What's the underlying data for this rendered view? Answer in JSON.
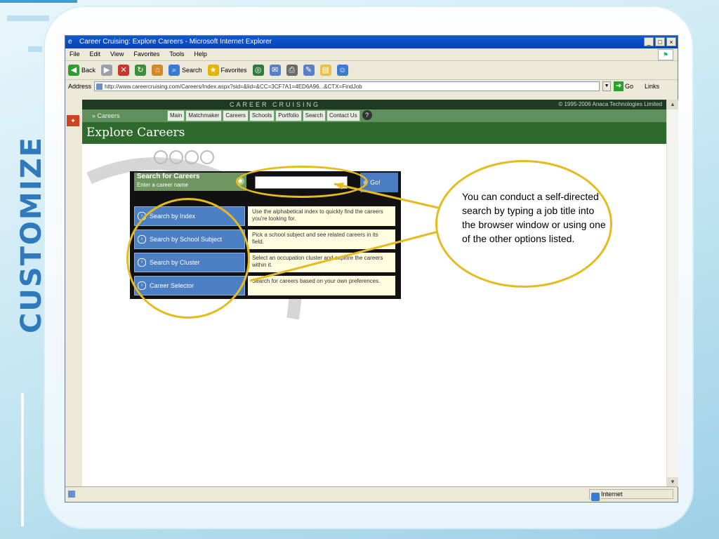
{
  "slide": {
    "vertical_title": "CUSTOMIZE"
  },
  "browser": {
    "title": "Career Cruising: Explore Careers - Microsoft Internet Explorer",
    "window_buttons": [
      "_",
      "□",
      "×"
    ],
    "menu": [
      "File",
      "Edit",
      "View",
      "Favorites",
      "Tools",
      "Help"
    ],
    "toolbar": [
      {
        "label": "Back",
        "icon": "back-arrow-icon",
        "color": "#2f9c2f"
      },
      {
        "label": "",
        "icon": "forward-arrow-icon",
        "color": "#9aa0a8"
      },
      {
        "label": "",
        "icon": "stop-icon",
        "color": "#c8362e"
      },
      {
        "label": "",
        "icon": "refresh-icon",
        "color": "#3c8f3c"
      },
      {
        "label": "",
        "icon": "home-icon",
        "color": "#d38a2a"
      },
      {
        "label": "Search",
        "icon": "search-icon",
        "color": "#3a7ad0"
      },
      {
        "label": "Favorites",
        "icon": "star-icon",
        "color": "#e4b500"
      },
      {
        "label": "",
        "icon": "media-icon",
        "color": "#2f7a3c"
      },
      {
        "label": "",
        "icon": "mail-icon",
        "color": "#5a7fc8"
      },
      {
        "label": "",
        "icon": "print-icon",
        "color": "#6a6a6a"
      },
      {
        "label": "",
        "icon": "edit-icon",
        "color": "#5a7fc8"
      },
      {
        "label": "",
        "icon": "folder-icon",
        "color": "#e7c04a"
      },
      {
        "label": "",
        "icon": "messenger-icon",
        "color": "#3a7ad0"
      }
    ],
    "address_label": "Address",
    "address_value": "http://www.careercruising.com/Careers/Index.aspx?sid=&lid=&CC=3CF7A1=4ED6A96...&CTX=FindJob",
    "go_label": "Go",
    "links_label": "Links",
    "status_zone": "Internet"
  },
  "page": {
    "brand_name": "CAREER CRUISING",
    "copyright": "© 1995-2006 Anaca Technologies Limited",
    "nav_careers": "» Careers",
    "nav_tabs": [
      "Main",
      "Matchmaker",
      "Careers",
      "Schools",
      "Portfolio",
      "Search",
      "Contact Us"
    ],
    "nav_help": "?",
    "title": "Explore Careers",
    "search": {
      "heading": "Search for Careers",
      "subheading": "Enter a career name",
      "go_label": "Go!",
      "rows": [
        {
          "label": "Search by Index",
          "desc": "Use the alphabetical index to quickly find the careers you're looking for."
        },
        {
          "label": "Search by School Subject",
          "desc": "Pick a school subject and see related careers in its field."
        },
        {
          "label": "Search by Cluster",
          "desc": "Select an occupation cluster and explore the careers within it."
        },
        {
          "label": "Career Selector",
          "desc": "Search for careers based on your own preferences."
        }
      ]
    }
  },
  "annotation": {
    "text": "You can conduct a self-directed search by typing a job title into the browser window or using one of the other options listed.",
    "color": "#e6bb1d"
  }
}
